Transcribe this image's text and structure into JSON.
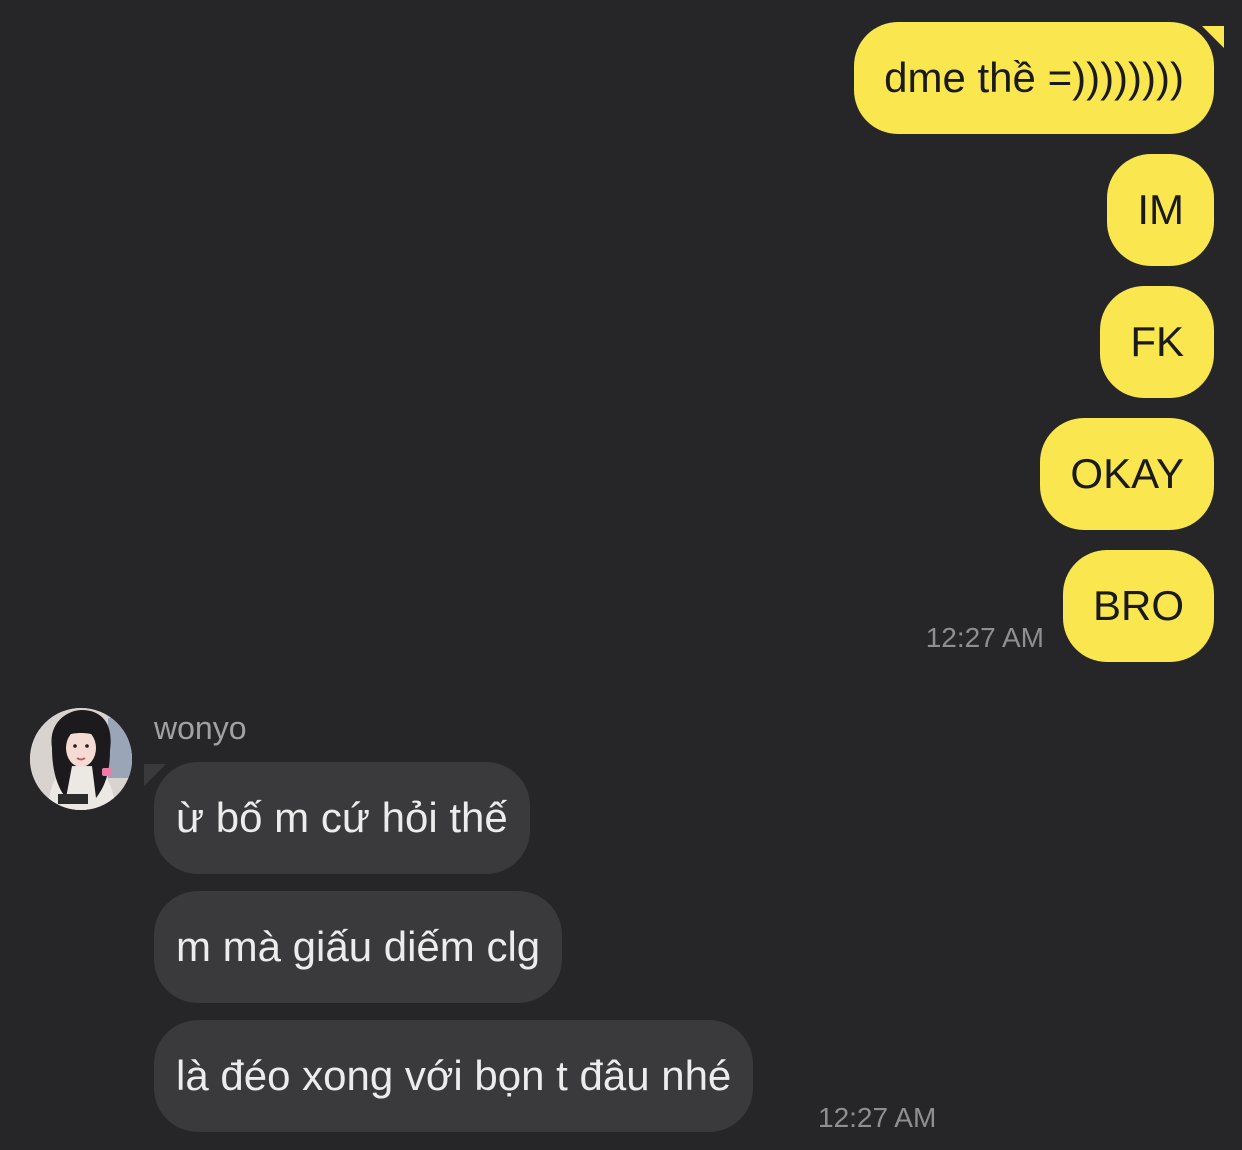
{
  "colors": {
    "background": "#262628",
    "sent_bubble": "#FAE64F",
    "received_bubble": "#3A3A3C",
    "timestamp": "#8E8E93"
  },
  "sent_messages": [
    {
      "text": "dme thề =))))))))"
    },
    {
      "text": "IM"
    },
    {
      "text": "FK"
    },
    {
      "text": "OKAY"
    },
    {
      "text": "BRO"
    }
  ],
  "sent_timestamp": "12:27 AM",
  "received": {
    "sender_name": "wonyo",
    "avatar_icon": "profile-photo",
    "messages": [
      {
        "text": "ừ bố m cứ hỏi thế"
      },
      {
        "text": "m mà giấu diếm clg"
      },
      {
        "text": "là đéo xong với bọn t đâu nhé"
      }
    ],
    "timestamp": "12:27 AM"
  }
}
